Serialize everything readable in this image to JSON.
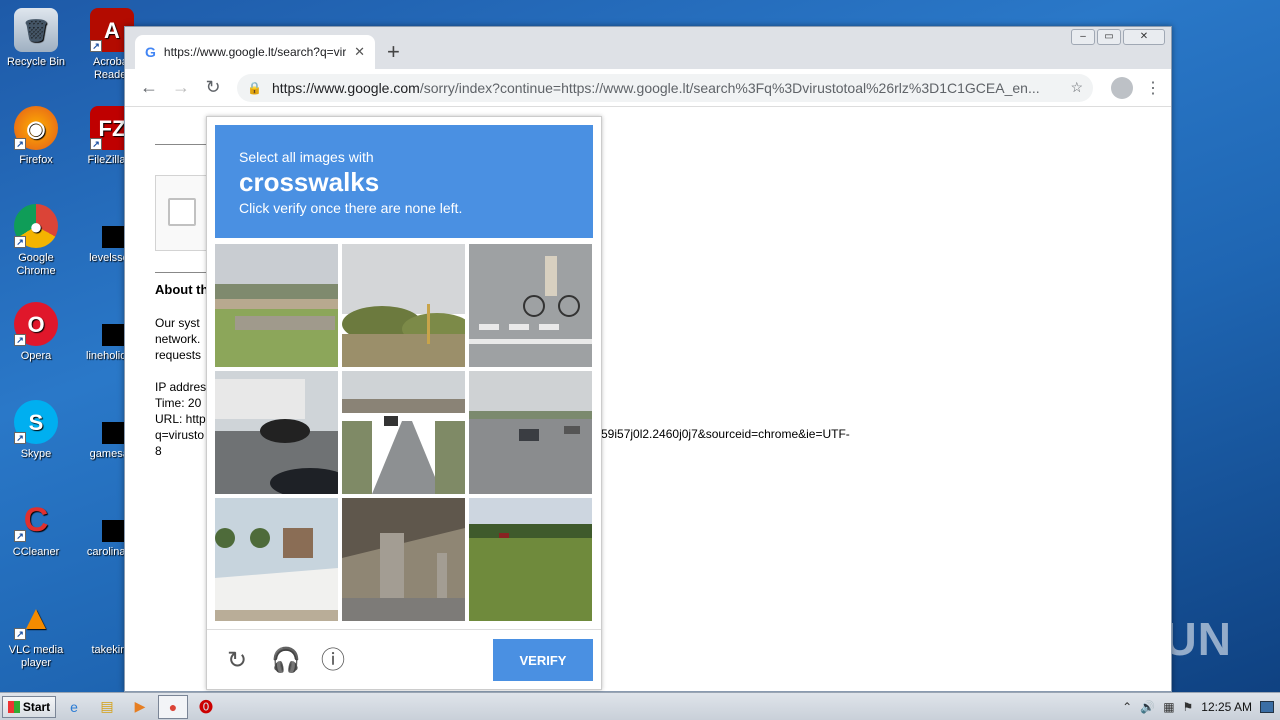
{
  "desktop": {
    "icons": [
      {
        "label": "Recycle Bin",
        "icon": "recycle-bin-icon"
      },
      {
        "label": "Acrobat Reader",
        "icon": "acrobat-icon"
      },
      {
        "label": "Firefox",
        "icon": "firefox-icon"
      },
      {
        "label": "FileZilla C",
        "icon": "filezilla-icon"
      },
      {
        "label": "Google Chrome",
        "icon": "chrome-icon"
      },
      {
        "label": "levelssep",
        "icon": "redacted-file-icon"
      },
      {
        "label": "Opera",
        "icon": "opera-icon"
      },
      {
        "label": "lineholiday",
        "icon": "redacted-file-icon"
      },
      {
        "label": "Skype",
        "icon": "skype-icon"
      },
      {
        "label": "gamesav",
        "icon": "redacted-file-icon"
      },
      {
        "label": "CCleaner",
        "icon": "ccleaner-icon"
      },
      {
        "label": "carolinaas",
        "icon": "redacted-file-icon"
      },
      {
        "label": "VLC media player",
        "icon": "vlc-icon"
      },
      {
        "label": "takeking",
        "icon": "redacted-file-icon"
      }
    ],
    "watermark": "ANY RUN"
  },
  "browser": {
    "tab_title": "https://www.google.lt/search?q=vir",
    "address": {
      "host": "https://www.google.com",
      "rest": "/sorry/index?continue=https://www.google.lt/search%3Fq%3Dvirustotoal%26rlz%3D1C1GCEA_en..."
    },
    "window_controls": {
      "minimize": "–",
      "restore": "▭",
      "close": "✕"
    }
  },
  "page": {
    "about_heading": "About th",
    "para1": [
      "Our syst",
      "network.",
      "requests"
    ],
    "para2": [
      "IP addres",
      "Time: 20",
      "URL: http",
      "q=virusto",
      "8"
    ],
    "url_tail": "59i57j0l2.2460j0j7&sourceid=chrome&ie=UTF-"
  },
  "captcha": {
    "instruction": "Select all images with",
    "target": "crosswalks",
    "hint": "Click verify once there are none left.",
    "verify_label": "VERIFY",
    "tiles": [
      "highway-bridge",
      "roadside-shrubs",
      "cyclist-on-crosswalk",
      "motorcyclist-traffic",
      "road-underpass",
      "highway-traffic",
      "palm-tree-wall",
      "bridge-pillar",
      "grassy-field"
    ]
  },
  "taskbar": {
    "start_label": "Start",
    "clock": "12:25 AM"
  }
}
